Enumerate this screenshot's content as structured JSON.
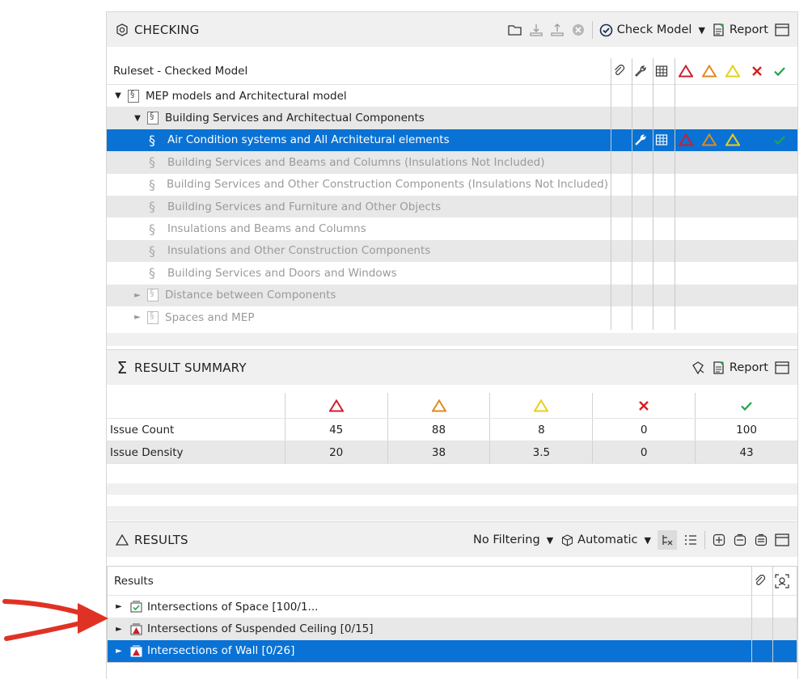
{
  "checking": {
    "title": "CHECKING",
    "check_model_label": "Check Model",
    "report_label": "Report",
    "column_header": "Ruleset - Checked Model",
    "tree": [
      {
        "label": "MEP models and Architectural model",
        "level": 0,
        "caret": "▼"
      },
      {
        "label": "Building Services and Architectual Components",
        "level": 1,
        "caret": "▼"
      },
      {
        "label": "Air Condition systems and All Architetural elements",
        "level": 2,
        "selected": true
      },
      {
        "label": "Building Services and Beams and Columns (Insulations Not Included)",
        "level": 2
      },
      {
        "label": "Building Services and Other Construction Components (Insulations Not Included)",
        "level": 2
      },
      {
        "label": "Building Services and Furniture and Other Objects",
        "level": 2
      },
      {
        "label": "Insulations and Beams and Columns",
        "level": 2
      },
      {
        "label": "Insulations and Other Construction Components",
        "level": 2
      },
      {
        "label": "Building Services and Doors and Windows",
        "level": 2
      },
      {
        "label": "Distance between Components",
        "level": 1,
        "caret": "►"
      },
      {
        "label": "Spaces and MEP",
        "level": 1,
        "caret": "►"
      }
    ]
  },
  "summary": {
    "title": "RESULT SUMMARY",
    "report_label": "Report",
    "rows": [
      {
        "label": "Issue Count",
        "values": [
          "45",
          "88",
          "8",
          "0",
          "100"
        ]
      },
      {
        "label": "Issue Density",
        "values": [
          "20",
          "38",
          "3.5",
          "0",
          "43"
        ]
      }
    ]
  },
  "results": {
    "title": "RESULTS",
    "filter_label": "No Filtering",
    "mode_label": "Automatic",
    "column_header": "Results",
    "items": [
      {
        "label": "Intersections of Space [100/1...",
        "status": "ok"
      },
      {
        "label": "Intersections of Suspended Ceiling [0/15]",
        "status": "critical"
      },
      {
        "label": "Intersections of Wall [0/26]",
        "status": "critical",
        "selected": true
      }
    ]
  },
  "colors": {
    "selection": "#0a72d4",
    "critical": "#cc1f2f",
    "moderate": "#e08a1e",
    "low": "#e8cf1a",
    "rejected": "#d81e1e",
    "accepted": "#1fa64a",
    "annotation_arrow": "#e03224"
  }
}
